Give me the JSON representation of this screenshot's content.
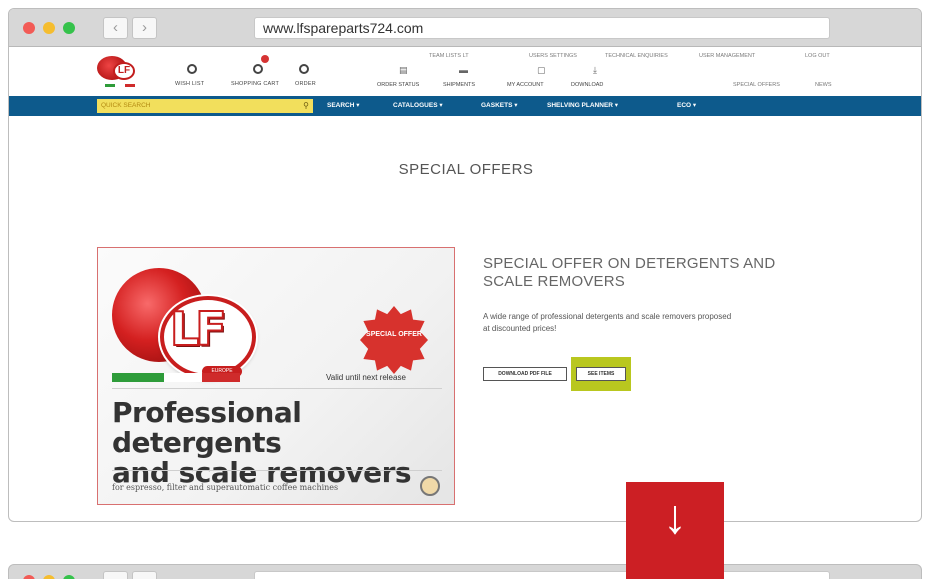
{
  "browser": {
    "url": "www.lfspareparts724.com",
    "back_glyph": "‹",
    "forward_glyph": "›"
  },
  "header": {
    "icons": [
      {
        "label": "WISH LIST",
        "icon": "wishlist-icon"
      },
      {
        "label": "SHOPPING CART",
        "icon": "cart-icon"
      },
      {
        "label": "ORDER",
        "icon": "order-icon"
      }
    ],
    "top_links": [
      "TEAM LISTS LT",
      "USERS SETTINGS",
      "TECHNICAL ENQUIRIES",
      "USER MANAGEMENT",
      "LOG OUT"
    ],
    "section_links": [
      {
        "label": "ORDER STATUS",
        "icon": "order-status-icon"
      },
      {
        "label": "SHIPMENTS",
        "icon": "truck-icon"
      },
      {
        "label": "MY ACCOUNT",
        "icon": "account-icon"
      },
      {
        "label": "DOWNLOAD",
        "icon": "download-icon"
      }
    ],
    "right_links": [
      "SPECIAL OFFERS",
      "NEWS"
    ]
  },
  "nav": {
    "quick_search_placeholder": "QUICK SEARCH",
    "menu": [
      "SEARCH ▾",
      "CATALOGUES ▾",
      "GASKETS ▾",
      "SHELVING PLANNER ▾",
      "ECO ▾"
    ]
  },
  "page": {
    "title": "SPECIAL OFFERS"
  },
  "promo": {
    "logo_text": "LF",
    "logo_tag": "EUROPE",
    "burst_text": "SPECIAL OFFER",
    "valid_text": "Valid until next release",
    "headline_line1": "Professional detergents",
    "headline_line2": "and scale removers",
    "tagline": "for espresso, filter and superautomatic coffee machines",
    "flag_colors": [
      "#2e9c3a",
      "#ffffff",
      "#cf2b2b"
    ]
  },
  "offer": {
    "title_line1": "SPECIAL OFFER ON DETERGENTS AND",
    "title_line2": "SCALE REMOVERS",
    "desc_line1": "A wide range of professional detergents and scale removers proposed",
    "desc_line2": "at discounted prices!",
    "pdf_button": "DOWNLOAD PDF FILE",
    "see_button": "SEE ITEMS"
  },
  "arrow": {
    "glyph": "↓"
  },
  "colors": {
    "nav_blue": "#0d5a8c",
    "quick_search_yellow": "#f2df5c",
    "highlight_green": "#b9c71f",
    "arrow_red": "#cc1f24"
  }
}
